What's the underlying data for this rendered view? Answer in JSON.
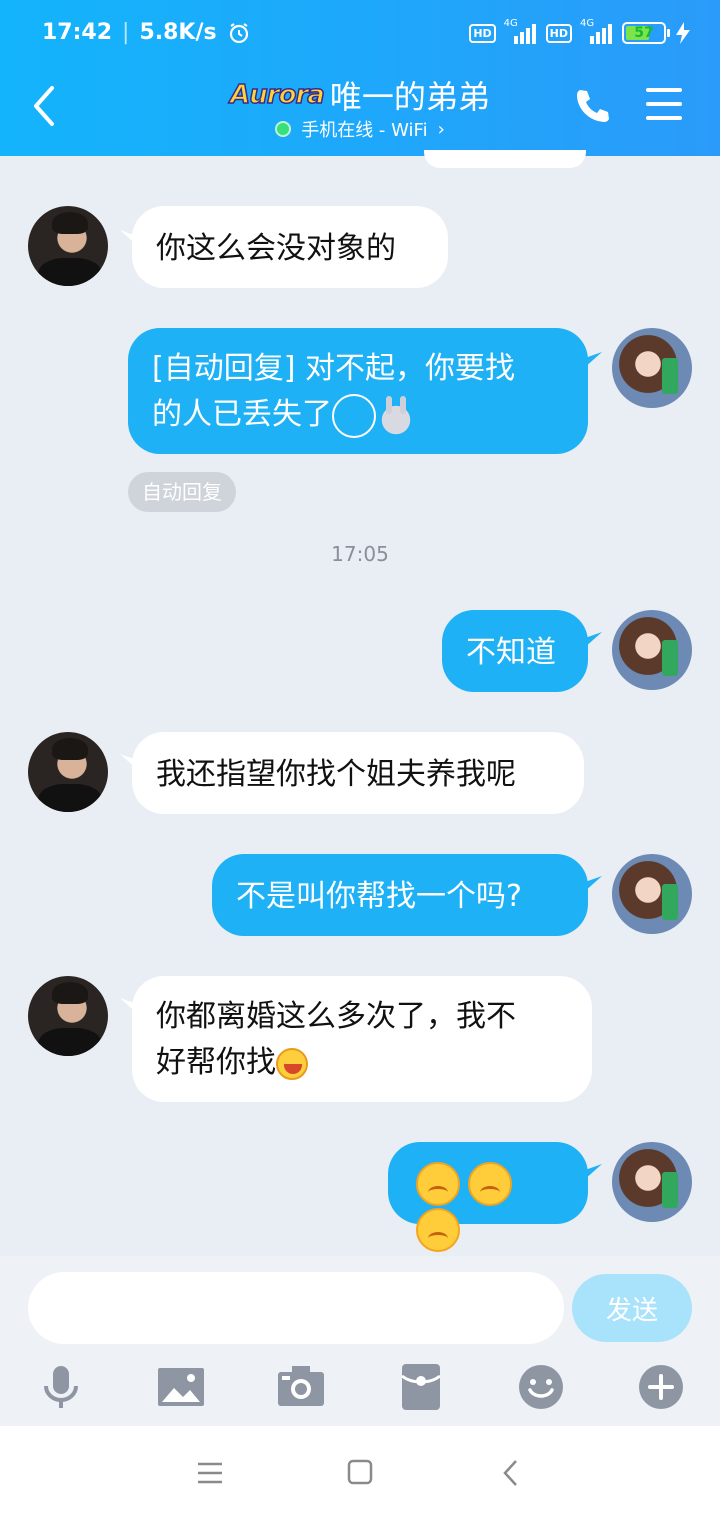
{
  "status_bar": {
    "time": "17:42",
    "speed": "5.8K/s",
    "hd1": "HD",
    "hd2": "HD",
    "net1": "4G",
    "net2": "4G",
    "battery": "57"
  },
  "header": {
    "badge": "Aurora",
    "contact_name": "唯一的弟弟",
    "status": "手机在线 - WiFi",
    "status_chevron": "›"
  },
  "messages": [
    {
      "side": "in",
      "text": "你这么会没对象的"
    },
    {
      "side": "out",
      "line1": "[自动回复] 对不起，你要找",
      "line2": "的人已丢失了"
    },
    {
      "side": "out",
      "text": "不知道"
    },
    {
      "side": "in",
      "text": "我还指望你找个姐夫养我呢"
    },
    {
      "side": "out",
      "text": "不是叫你帮找一个吗?"
    },
    {
      "side": "in",
      "line1": "你都离婚这么多次了，我不",
      "line2": "好帮你找"
    }
  ],
  "auto_reply_tag": "自动回复",
  "timestamp": "17:05",
  "input": {
    "placeholder": "",
    "send_label": "发送"
  },
  "colors": {
    "header": "#1ea8fb",
    "out_bubble": "#1fb1f5",
    "background": "#e9edf4"
  }
}
